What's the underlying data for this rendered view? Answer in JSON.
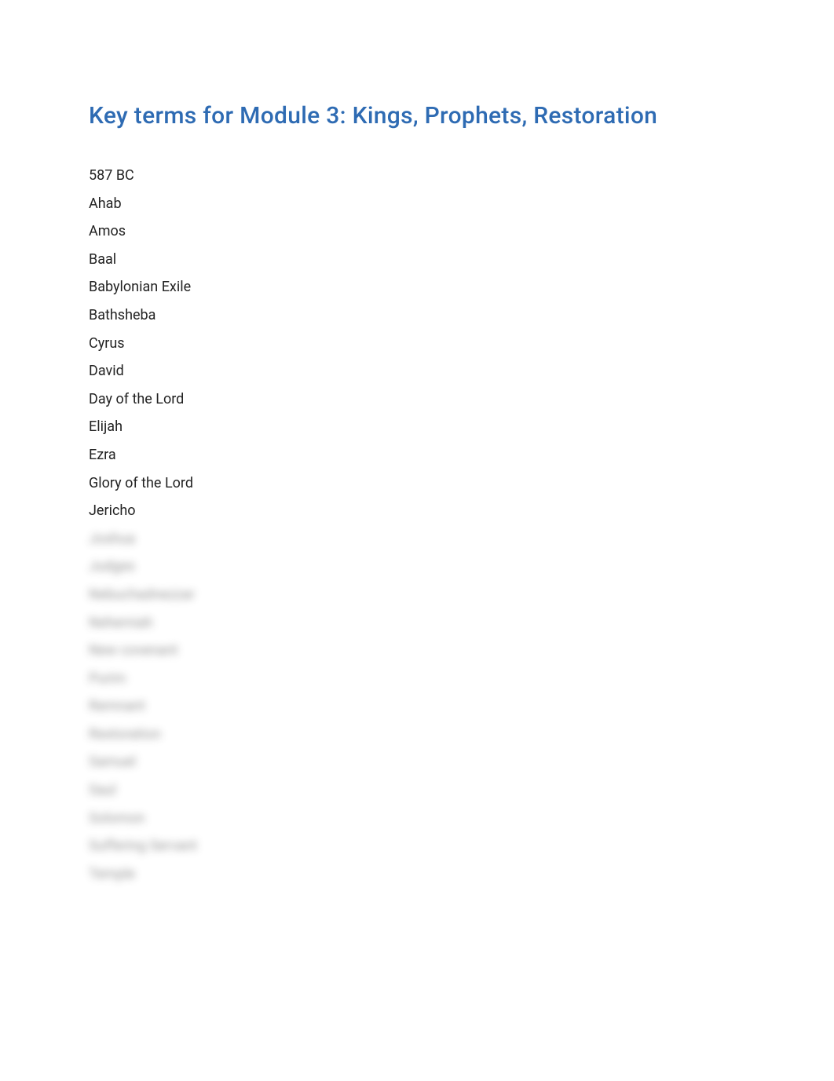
{
  "title": "Key terms for Module 3: Kings, Prophets, Restoration",
  "terms": [
    {
      "label": "587 BC",
      "blurred": false
    },
    {
      "label": "Ahab",
      "blurred": false
    },
    {
      "label": "Amos",
      "blurred": false
    },
    {
      "label": "Baal",
      "blurred": false
    },
    {
      "label": "Babylonian Exile",
      "blurred": false
    },
    {
      "label": "Bathsheba",
      "blurred": false
    },
    {
      "label": "Cyrus",
      "blurred": false
    },
    {
      "label": "David",
      "blurred": false
    },
    {
      "label": "Day of the Lord",
      "blurred": false
    },
    {
      "label": "Elijah",
      "blurred": false
    },
    {
      "label": "Ezra",
      "blurred": false
    },
    {
      "label": "Glory of the Lord",
      "blurred": false
    },
    {
      "label": "Jericho",
      "blurred": false
    },
    {
      "label": "Joshua",
      "blurred": true
    },
    {
      "label": "Judges",
      "blurred": true
    },
    {
      "label": "Nebuchadnezzar",
      "blurred": true
    },
    {
      "label": "Nehemiah",
      "blurred": true
    },
    {
      "label": "New covenant",
      "blurred": true
    },
    {
      "label": "Purim",
      "blurred": true
    },
    {
      "label": "Remnant",
      "blurred": true
    },
    {
      "label": "Restoration",
      "blurred": true
    },
    {
      "label": "Samuel",
      "blurred": true
    },
    {
      "label": "Saul",
      "blurred": true
    },
    {
      "label": "Solomon",
      "blurred": true
    },
    {
      "label": "Suffering Servant",
      "blurred": true
    },
    {
      "label": "Temple",
      "blurred": true
    }
  ]
}
